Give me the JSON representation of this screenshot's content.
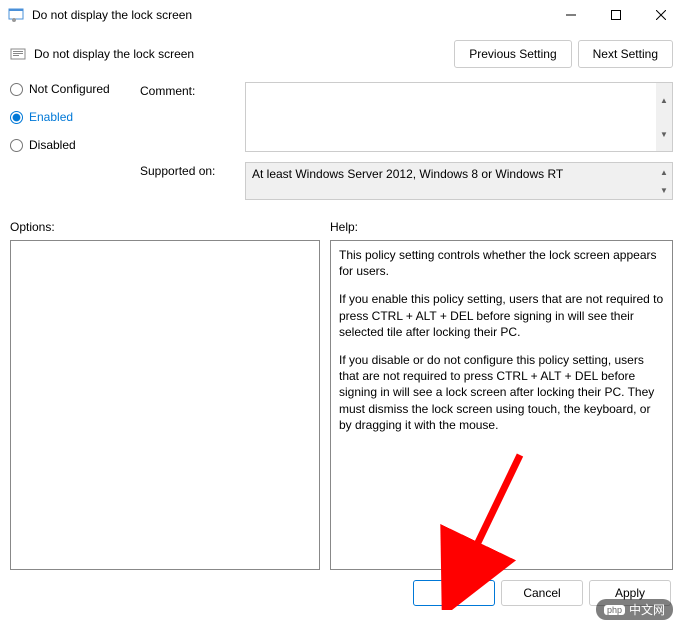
{
  "window": {
    "title": "Do not display the lock screen"
  },
  "header": {
    "title": "Do not display the lock screen",
    "prev_btn": "Previous Setting",
    "next_btn": "Next Setting"
  },
  "radio": {
    "not_configured": "Not Configured",
    "enabled": "Enabled",
    "disabled": "Disabled",
    "selected": "enabled"
  },
  "fields": {
    "comment_label": "Comment:",
    "comment_value": "",
    "supported_label": "Supported on:",
    "supported_value": "At least Windows Server 2012, Windows 8 or Windows RT"
  },
  "labels": {
    "options": "Options:",
    "help": "Help:"
  },
  "help": {
    "p1": "This policy setting controls whether the lock screen appears for users.",
    "p2": "If you enable this policy setting, users that are not required to press CTRL + ALT + DEL before signing in will see their selected tile after locking their PC.",
    "p3": "If you disable or do not configure this policy setting, users that are not required to press CTRL + ALT + DEL before signing in will see a lock screen after locking their PC. They must dismiss the lock screen using touch, the keyboard, or by dragging it with the mouse."
  },
  "footer": {
    "ok": "OK",
    "cancel": "Cancel",
    "apply": "Apply"
  },
  "watermark": "中文网"
}
